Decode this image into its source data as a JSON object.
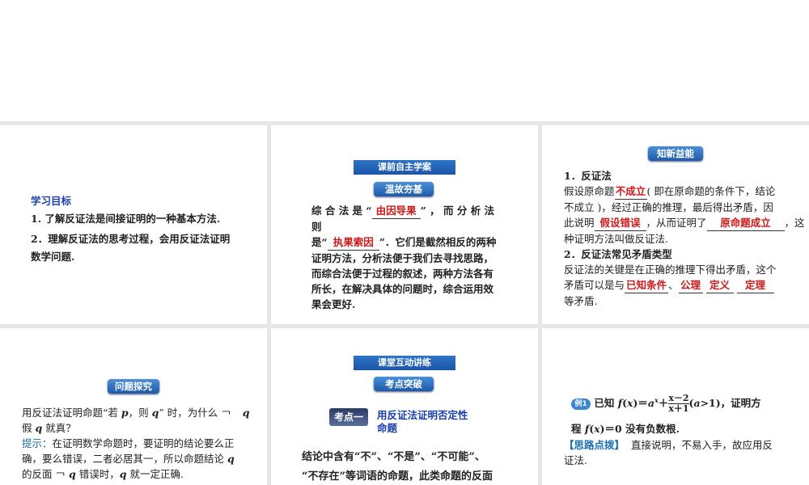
{
  "slide1": {
    "heading": "学习目标",
    "item1": "1. 了解反证法是间接证明的一种基本方法.",
    "item2_line1": "2．理解反证法的思考过程，会用反证法证明",
    "item2_line2": "数学问题."
  },
  "slide2": {
    "bar": "课前自主学案",
    "pill": "温故夯基",
    "p_a": "综 合 法 是 “",
    "blank1": "由因导果",
    "p_b": "” ， 而 分 析 法 则",
    "p_c": "是“",
    "blank2": "执果索因",
    "p_d": "”．它们是截然相反的两种",
    "line3": "证明方法，分析法便于我们去寻找思路，",
    "line4": "而综合法便于过程的叙述，两种方法各有",
    "line5": "所长，在解决具体的问题时，综合运用效",
    "line6": "果会更好."
  },
  "slide3": {
    "pill": "知新益能",
    "sec1_title": "1．反证法",
    "l1a": "假设原命题",
    "blank1": "不成立",
    "l1b": "( 即在原命题的条件下，结论",
    "l2": "不成立 )，经过正确的推理，最后得出矛盾，因",
    "l3a": "此说明",
    "blank2": "假设错误",
    "l3b": "，从而证明了",
    "blank3": "原命题成立",
    "l3c": "，这",
    "l4": "种证明方法叫做反证法.",
    "sec2_title": "2．反证法常见矛盾类型",
    "l5": "反证法的关键是在正确的推理下得出矛盾，这个",
    "l6a": "矛盾可以是与",
    "blank4": "已知条件",
    "sep1": "、",
    "blank5": "公理",
    "blank6": "定义",
    "blank7": "定理",
    "l7": "等矛盾."
  },
  "slide4": {
    "pill": "问题探究",
    "q1a": "用反证法证明命题“若 ",
    "q1p": "p",
    "q1b": "，则 ",
    "q1q": "q",
    "q1c": "” 时，为什么",
    "neg": "￢",
    "q1d": "q",
    "q2a": "假 ",
    "q2q": "q",
    "q2b": " 就真？",
    "hint_label": "提示：",
    "h1": "在证明数学命题时，要证明的结论要么正",
    "h2a": "确，要么错误，二者必居其一，所以命题结论 ",
    "h2q": "q",
    "h3a": "的反面",
    "h3neg": "￢",
    "h3q": "q",
    "h3b": " 错误时，",
    "h3q2": "q",
    "h3c": " 就一定正确."
  },
  "slide5": {
    "bar": "课堂互动讲练",
    "pill": "考点突破",
    "kaodian": "考点一",
    "topic1": "用反证法证明否定性",
    "topic2": "命题",
    "body1": "结论中含有“不”、“不是”、“不可能”、",
    "body2": "“不存在”等词语的命题，此类命题的反面"
  },
  "slide6": {
    "badge": "例1",
    "e1a": "已知 ",
    "e1f": "f",
    "e1b": "(",
    "e1x": "x",
    "e1c": ")＝",
    "e1a2": "a",
    "e1sup": "x",
    "e1plus": "＋",
    "num": "x－2",
    "den": "x＋1",
    "e1d": "(",
    "e1a3": "a",
    "e1e": ">1)，证明方",
    "e2a": "程 ",
    "e2f": "f",
    "e2b": "(",
    "e2x": "x",
    "e2c": ")＝0 没有负数根.",
    "tip_label": "【思路点拨】",
    "tip1": "直接说明，不易入手，故应用反",
    "tip2": "证法."
  }
}
